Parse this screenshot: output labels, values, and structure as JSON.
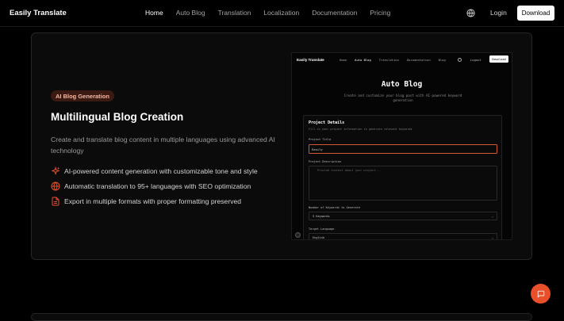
{
  "nav": {
    "brand": "Easily Translate",
    "links": [
      {
        "label": "Home",
        "active": true
      },
      {
        "label": "Auto Blog",
        "active": false
      },
      {
        "label": "Translation",
        "active": false
      },
      {
        "label": "Localization",
        "active": false
      },
      {
        "label": "Documentation",
        "active": false
      },
      {
        "label": "Pricing",
        "active": false
      }
    ],
    "globe_icon": "globe-icon",
    "login": "Login",
    "download": "Download"
  },
  "feature_card": {
    "badge": "AI Blog Generation",
    "title": "Multilingual Blog Creation",
    "description": "Create and translate blog content in multiple languages using advanced AI technology",
    "features": [
      {
        "icon": "sparkle-icon",
        "text": "AI-powered content generation with customizable tone and style"
      },
      {
        "icon": "globe-icon",
        "text": "Automatic translation to 95+ languages with SEO optimization"
      },
      {
        "icon": "document-icon",
        "text": "Export in multiple formats with proper formatting preserved"
      }
    ]
  },
  "preview": {
    "brand": "Easily Translate",
    "links": [
      {
        "label": "Home",
        "active": false
      },
      {
        "label": "Auto Blog",
        "active": true
      },
      {
        "label": "Translation",
        "active": false
      },
      {
        "label": "Documentation",
        "active": false
      },
      {
        "label": "Blog",
        "active": false
      }
    ],
    "login": "Logout",
    "download": "Download",
    "heading": "Auto Blog",
    "subheading": "Create and customize your blog post with AI-powered keyword generation",
    "form": {
      "title": "Project Details",
      "subtitle": "Fill in your project information to generate relevant keywords",
      "project_title_label": "Project Title",
      "project_title_value": "Easily",
      "description_label": "Project Description",
      "description_placeholder": "Provide context about your project...",
      "keywords_label": "Number of Keywords to Generate",
      "keywords_value": "5 Keywords",
      "language_label": "Target Language",
      "language_value": "English"
    }
  },
  "fab": {
    "icon": "chat-icon"
  },
  "colors": {
    "accent": "#e8502c",
    "badge_bg": "#3a1a12",
    "badge_text": "#f5b8a3"
  }
}
